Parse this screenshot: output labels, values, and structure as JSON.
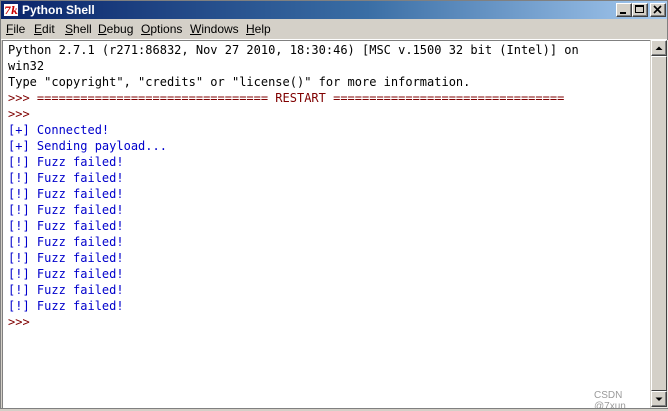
{
  "window": {
    "title": "Python Shell",
    "icon": "python-idle-icon"
  },
  "menu": {
    "items": [
      {
        "label": "File",
        "mnemonic": "F",
        "rest": "ile"
      },
      {
        "label": "Edit",
        "mnemonic": "E",
        "rest": "dit"
      },
      {
        "label": "Shell",
        "mnemonic": "S",
        "rest": "hell"
      },
      {
        "label": "Debug",
        "mnemonic": "D",
        "rest": "ebug"
      },
      {
        "label": "Options",
        "mnemonic": "O",
        "rest": "ptions"
      },
      {
        "label": "Windows",
        "mnemonic": "W",
        "rest": "indows"
      },
      {
        "label": "Help",
        "mnemonic": "H",
        "rest": "elp"
      }
    ]
  },
  "shell": {
    "lines": [
      {
        "text": "Python 2.7.1 (r271:86832, Nov 27 2010, 18:30:46) [MSC v.1500 32 bit (Intel)] on",
        "kind": "output"
      },
      {
        "text": "win32",
        "kind": "output"
      },
      {
        "text": "Type \"copyright\", \"credits\" or \"license()\" for more information.",
        "kind": "output"
      },
      {
        "text": ">>> ================================ RESTART ================================",
        "kind": "prompt"
      },
      {
        "text": ">>>",
        "kind": "prompt"
      },
      {
        "text": "[+] Connected!",
        "kind": "stdout"
      },
      {
        "text": "[+] Sending payload...",
        "kind": "stdout"
      },
      {
        "text": "[!] Fuzz failed!",
        "kind": "stdout"
      },
      {
        "text": "[!] Fuzz failed!",
        "kind": "stdout"
      },
      {
        "text": "[!] Fuzz failed!",
        "kind": "stdout"
      },
      {
        "text": "[!] Fuzz failed!",
        "kind": "stdout"
      },
      {
        "text": "[!] Fuzz failed!",
        "kind": "stdout"
      },
      {
        "text": "[!] Fuzz failed!",
        "kind": "stdout"
      },
      {
        "text": "[!] Fuzz failed!",
        "kind": "stdout"
      },
      {
        "text": "[!] Fuzz failed!",
        "kind": "stdout"
      },
      {
        "text": "[!] Fuzz failed!",
        "kind": "stdout"
      },
      {
        "text": "[!] Fuzz failed!",
        "kind": "stdout"
      },
      {
        "text": ">>>",
        "kind": "prompt"
      }
    ]
  },
  "watermark": {
    "text": "CSDN @7xun"
  },
  "colors": {
    "titlebar_start": "#0a246a",
    "titlebar_end": "#a6caf0",
    "output": "#000000",
    "prompt": "#7f0000",
    "stdout": "#0000cc"
  }
}
